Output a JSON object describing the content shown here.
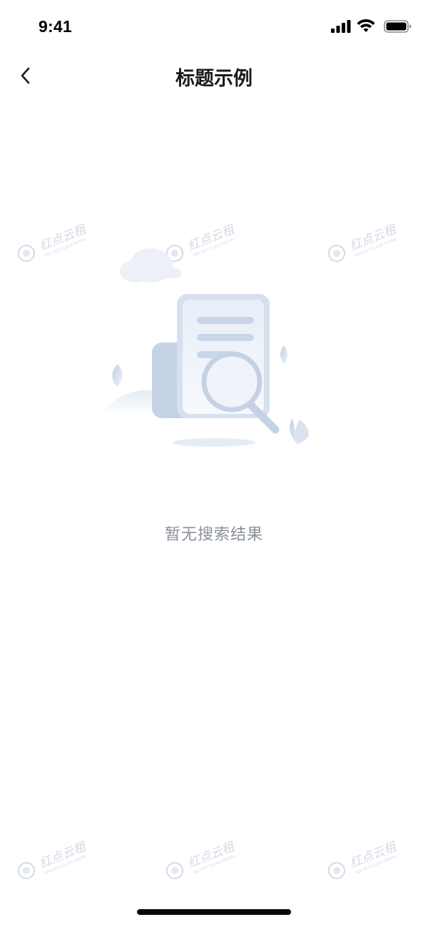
{
  "status_bar": {
    "time": "9:41"
  },
  "nav": {
    "title": "标题示例"
  },
  "empty_state": {
    "message": "暂无搜索结果"
  },
  "watermark": {
    "brand_cn": "红点云租",
    "brand_en": "RED DOT CLOUD RENTAL"
  },
  "colors": {
    "illustration_primary": "#c5d2e6",
    "illustration_light": "#eef2f8",
    "message_text": "#8a8f99",
    "watermark": "#d3dae6"
  }
}
